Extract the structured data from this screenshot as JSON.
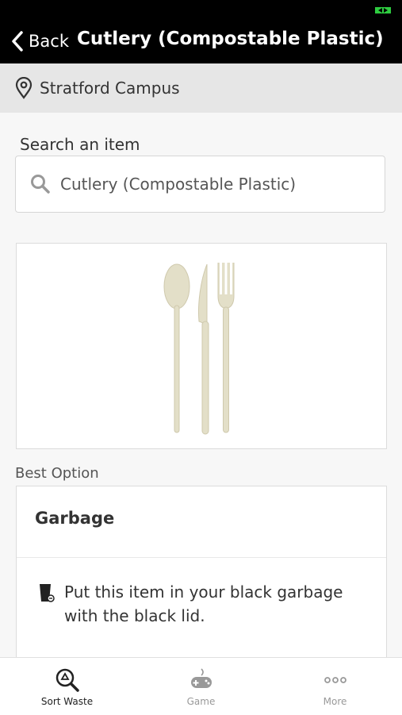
{
  "header": {
    "back_label": "Back",
    "title": "Cutlery (Compostable Plastic)",
    "battery_color": "#2ecc40"
  },
  "location": {
    "name": "Stratford Campus",
    "icon": "location-pin-icon"
  },
  "search": {
    "label": "Search an item",
    "value": "Cutlery (Compostable Plastic)",
    "icon": "search-icon"
  },
  "item_image": {
    "icon": "cutlery-image"
  },
  "best_option": {
    "label": "Best Option",
    "title": "Garbage",
    "icon": "garbage-bin-icon",
    "instruction": "Put this item in your black garbage with the black lid."
  },
  "tabs": [
    {
      "label": "Sort Waste",
      "icon": "recycle-search-icon",
      "active": true
    },
    {
      "label": "Game",
      "icon": "gamepad-icon",
      "active": false
    },
    {
      "label": "More",
      "icon": "more-dots-icon",
      "active": false
    }
  ],
  "colors": {
    "header_bg": "#000000",
    "active_tab": "#222222",
    "inactive_tab": "#999999"
  }
}
